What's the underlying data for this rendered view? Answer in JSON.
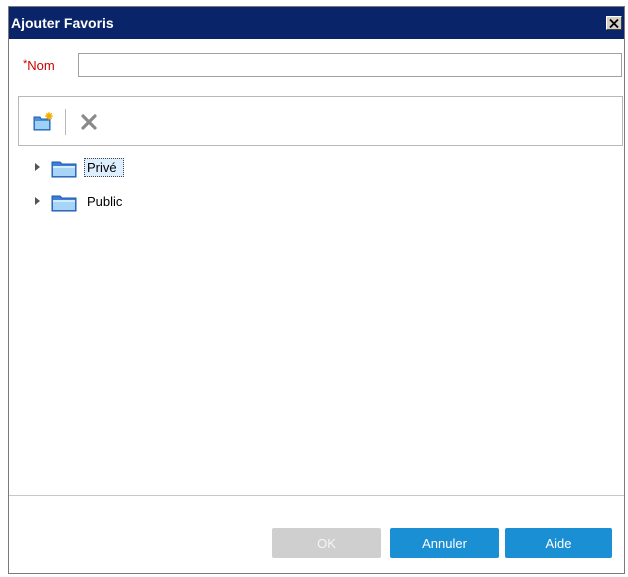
{
  "dialog": {
    "title": "Ajouter Favoris",
    "close_label": "✕"
  },
  "name_field": {
    "required_mark": "*",
    "label": "Nom",
    "value": "",
    "placeholder": ""
  },
  "toolbar": {
    "new_folder_icon": "new-folder-icon",
    "delete_icon": "delete-icon"
  },
  "tree": {
    "items": [
      {
        "label": "Privé",
        "icon": "folder-icon",
        "selected": true
      },
      {
        "label": "Public",
        "icon": "folder-icon",
        "selected": false
      }
    ]
  },
  "buttons": {
    "ok": "OK",
    "cancel": "Annuler",
    "help": "Aide"
  },
  "colors": {
    "titlebar": "#0a246a",
    "required": "#cc0000",
    "primary_button": "#1a8fd4",
    "disabled_button": "#cfcfcf"
  }
}
